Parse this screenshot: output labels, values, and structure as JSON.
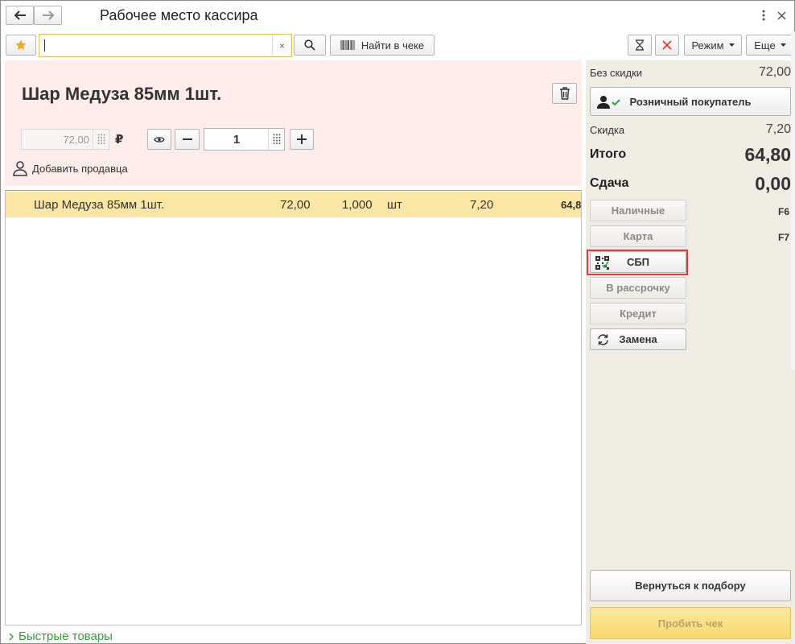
{
  "window": {
    "title": "Рабочее место кассира"
  },
  "toolbar": {
    "find_in_check_label": "Найти в чеке",
    "mode_label": "Режим",
    "more_label": "Еще",
    "search_clear_label": "×"
  },
  "product": {
    "name": "Шар Медуза 85мм 1шт.",
    "price": "72,00",
    "currency": "₽",
    "quantity": "1",
    "add_seller_label": "Добавить продавца"
  },
  "check_rows": [
    {
      "name": "Шар Медуза 85мм 1шт.",
      "price": "72,00",
      "quantity": "1,000",
      "unit": "шт",
      "discount": "7,20",
      "sum": "64,8"
    }
  ],
  "fast_goods_label": "Быстрые товары",
  "summary": {
    "without_discount_label": "Без скидки",
    "without_discount_value": "72,00",
    "customer_label": "Розничный покупатель",
    "discount_label": "Скидка",
    "discount_value": "7,20",
    "total_label": "Итого",
    "total_value": "64,80",
    "change_label": "Сдача",
    "change_value": "0,00"
  },
  "payments": [
    {
      "label": "Наличные",
      "hotkey": "F6"
    },
    {
      "label": "Карта",
      "hotkey": "F7"
    },
    {
      "label": "СБП"
    },
    {
      "label": "В рассрочку"
    },
    {
      "label": "Кредит"
    },
    {
      "label": "Замена"
    }
  ],
  "bottom": {
    "return_label": "Вернуться к подбору",
    "punch_label": "Пробить чек"
  },
  "colors": {
    "accent_yellow": "#fbe6a4",
    "highlight_red": "#e23b3b",
    "pink_panel": "#fdeceb",
    "right_panel": "#eeece3",
    "fast_goods_green": "#3c9a39"
  }
}
